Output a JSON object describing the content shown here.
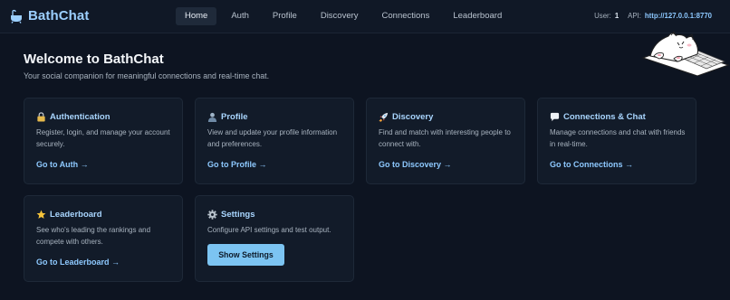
{
  "app": {
    "name": "BathChat"
  },
  "nav": {
    "items": [
      {
        "label": "Home",
        "active": true
      },
      {
        "label": "Auth"
      },
      {
        "label": "Profile"
      },
      {
        "label": "Discovery"
      },
      {
        "label": "Connections"
      },
      {
        "label": "Leaderboard"
      }
    ]
  },
  "meta": {
    "user_label": "User:",
    "user_value": "1",
    "api_label": "API:",
    "api_value": "http://127.0.0.1:8770"
  },
  "hero": {
    "title": "Welcome to BathChat",
    "subtitle": "Your social companion for meaningful connections and real-time chat."
  },
  "cards": {
    "auth": {
      "title": "Authentication",
      "icon": "lock-icon",
      "desc": "Register, login, and manage your account securely.",
      "link": "Go to Auth →"
    },
    "profile": {
      "title": "Profile",
      "icon": "user-icon",
      "desc": "View and update your profile information and preferences.",
      "link": "Go to Profile →"
    },
    "discovery": {
      "title": "Discovery",
      "icon": "rocket-icon",
      "desc": "Find and match with interesting people to connect with.",
      "link": "Go to Discovery →"
    },
    "connections": {
      "title": "Connections & Chat",
      "icon": "speech-bubble-icon",
      "desc": "Manage connections and chat with friends in real-time.",
      "link": "Go to Connections →"
    },
    "leaderboard": {
      "title": "Leaderboard",
      "icon": "star-icon",
      "desc": "See who's leading the rankings and compete with others.",
      "link": "Go to Leaderboard →"
    },
    "settings": {
      "title": "Settings",
      "icon": "gear-icon",
      "desc": "Configure API settings and test output.",
      "button": "Show Settings"
    }
  },
  "colors": {
    "background": "#0d1421",
    "card": "#121b29",
    "accent": "#8ec9ff",
    "button": "#7cc4f2"
  }
}
